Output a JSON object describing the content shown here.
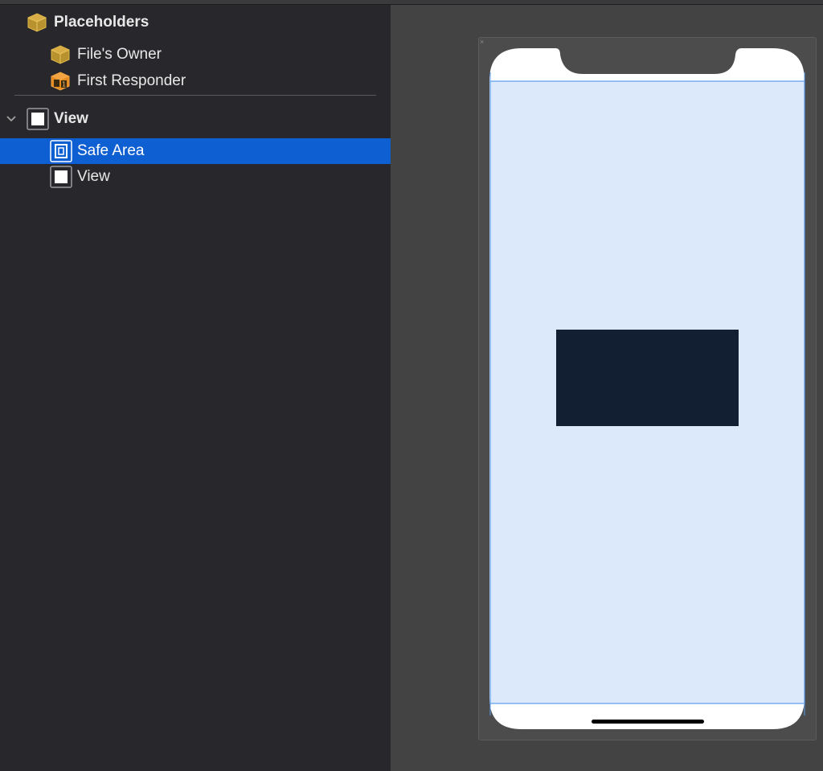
{
  "outline": {
    "placeholders": {
      "label": "Placeholders",
      "icon": "cube-icon",
      "items": [
        {
          "label": "File's Owner",
          "icon": "cube-icon"
        },
        {
          "label": "First Responder",
          "icon": "first-responder-icon"
        }
      ]
    },
    "view": {
      "label": "View",
      "icon": "view-icon",
      "expanded": true,
      "children": [
        {
          "label": "Safe Area",
          "icon": "safe-area-icon",
          "selected": true
        },
        {
          "label": "View",
          "icon": "view-icon",
          "selected": false
        }
      ]
    }
  },
  "canvas": {
    "device": "iPhone",
    "colors": {
      "safe_area_fill": "#dce9fb",
      "safe_area_border": "#5b9bec",
      "inner_view": "#121f33",
      "phone_body": "#ffffff",
      "selection": "#0e5fd1"
    }
  }
}
